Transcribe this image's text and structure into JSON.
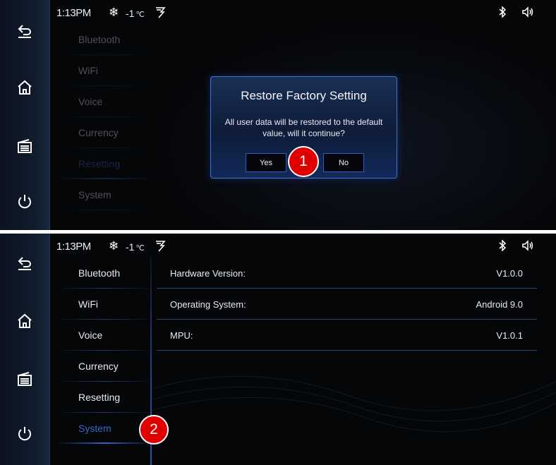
{
  "status_bar": {
    "time": "1:13PM",
    "snow_glyph": "❄",
    "temperature": "-1",
    "temperature_unit": "℃"
  },
  "rail_icons": [
    "back-icon",
    "home-icon",
    "radio-icon",
    "power-icon"
  ],
  "menu": {
    "items": [
      {
        "label": "Bluetooth"
      },
      {
        "label": "WiFi"
      },
      {
        "label": "Voice"
      },
      {
        "label": "Currency"
      },
      {
        "label": "Resetting"
      },
      {
        "label": "System"
      }
    ]
  },
  "screen_top": {
    "active_item": "Resetting",
    "dialog": {
      "title": "Restore Factory Setting",
      "message": "All user data will be restored to the default value, will it continue?",
      "yes_label": "Yes",
      "no_label": "No"
    },
    "callout": "1"
  },
  "screen_bottom": {
    "active_item": "System",
    "info": [
      {
        "label": "Hardware Version:",
        "value": "V1.0.0"
      },
      {
        "label": "Operating System:",
        "value": "Android 9.0"
      },
      {
        "label": "MPU:",
        "value": "V1.0.1"
      }
    ],
    "callout": "2"
  },
  "colors": {
    "accent_blue": "#2e63c8",
    "active_text": "#3b67c6",
    "callout_red": "#e00000",
    "background": "#050608"
  }
}
